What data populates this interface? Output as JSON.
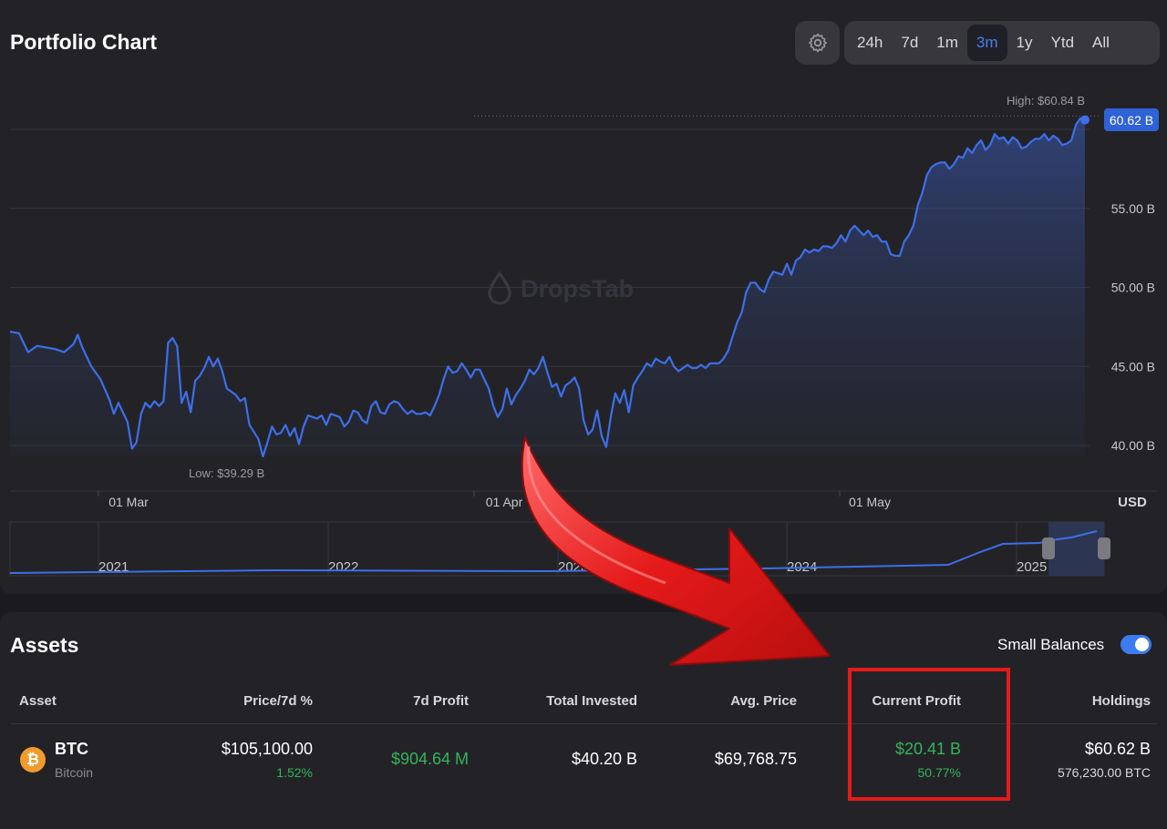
{
  "header": {
    "title": "Portfolio Chart",
    "settings_icon": "gear-icon",
    "ranges": [
      "24h",
      "7d",
      "1m",
      "3m",
      "1y",
      "Ytd",
      "All"
    ],
    "active_range": "3m"
  },
  "chart": {
    "watermark": "DropsTab",
    "high_label": "High: $60.84 B",
    "low_label": "Low: $39.29 B",
    "current_badge": "60.62 B",
    "currency": "USD",
    "navigator_years": [
      "2021",
      "2022",
      "2023",
      "2024",
      "2025"
    ]
  },
  "chart_data": {
    "type": "area",
    "title": "Portfolio Chart",
    "ylabel": "USD",
    "y_ticks": [
      "40.00 B",
      "45.00 B",
      "50.00 B",
      "55.00 B"
    ],
    "x_ticks": [
      "01 Mar",
      "01 Apr",
      "01 May"
    ],
    "ylim": [
      37.1,
      62.2
    ],
    "high": 60.84,
    "low": 39.29,
    "current": 60.62,
    "series": [
      {
        "color": "#3d6fe8",
        "points": [
          [
            0,
            47.2
          ],
          [
            2,
            47.1
          ],
          [
            4,
            45.9
          ],
          [
            6,
            46.3
          ],
          [
            8,
            46.2
          ],
          [
            10,
            46.1
          ],
          [
            12,
            45.9
          ],
          [
            14,
            46.4
          ],
          [
            15,
            47.0
          ],
          [
            16,
            46.2
          ],
          [
            18,
            45.0
          ],
          [
            19,
            44.6
          ],
          [
            20,
            44.2
          ],
          [
            22,
            42.9
          ],
          [
            23,
            42.0
          ],
          [
            24,
            42.7
          ],
          [
            26,
            41.5
          ],
          [
            27,
            39.8
          ],
          [
            28,
            40.2
          ],
          [
            29,
            42.0
          ],
          [
            30,
            42.7
          ],
          [
            31,
            42.4
          ],
          [
            32,
            42.8
          ],
          [
            33,
            42.5
          ],
          [
            34,
            42.8
          ],
          [
            35,
            46.5
          ],
          [
            36,
            46.8
          ],
          [
            37,
            46.3
          ],
          [
            38,
            42.7
          ],
          [
            39,
            43.4
          ],
          [
            40,
            42.1
          ],
          [
            41,
            44.1
          ],
          [
            42,
            44.4
          ],
          [
            43,
            44.9
          ],
          [
            44,
            45.6
          ],
          [
            45,
            45.0
          ],
          [
            46,
            45.5
          ],
          [
            47,
            44.7
          ],
          [
            48,
            43.6
          ],
          [
            50,
            43.2
          ],
          [
            51,
            42.8
          ],
          [
            52,
            43.0
          ],
          [
            53,
            41.3
          ],
          [
            55,
            40.4
          ],
          [
            56,
            39.3
          ],
          [
            57,
            40.2
          ],
          [
            58,
            41.2
          ],
          [
            59,
            40.7
          ],
          [
            60,
            40.8
          ],
          [
            61,
            41.3
          ],
          [
            62,
            40.6
          ],
          [
            63,
            41.1
          ],
          [
            64,
            40.1
          ],
          [
            65,
            41.2
          ],
          [
            66,
            41.9
          ],
          [
            67,
            41.8
          ],
          [
            68,
            41.7
          ],
          [
            69,
            41.9
          ],
          [
            70,
            41.3
          ],
          [
            71,
            42.0
          ],
          [
            72,
            41.9
          ],
          [
            73,
            41.8
          ],
          [
            74,
            41.2
          ],
          [
            75,
            41.5
          ],
          [
            76,
            42.2
          ],
          [
            77,
            42.1
          ],
          [
            78,
            41.6
          ],
          [
            79,
            41.4
          ],
          [
            80,
            42.5
          ],
          [
            81,
            42.8
          ],
          [
            82,
            42.1
          ],
          [
            83,
            42.0
          ],
          [
            84,
            42.6
          ],
          [
            85,
            42.8
          ],
          [
            86,
            42.7
          ],
          [
            87,
            42.3
          ],
          [
            88,
            42.0
          ],
          [
            89,
            42.2
          ],
          [
            90,
            42.0
          ],
          [
            91,
            42.0
          ],
          [
            92,
            42.1
          ],
          [
            93,
            41.9
          ],
          [
            94,
            42.5
          ],
          [
            95,
            43.2
          ],
          [
            96,
            44.2
          ],
          [
            97,
            45.0
          ],
          [
            98,
            44.6
          ],
          [
            99,
            44.7
          ],
          [
            100,
            45.2
          ],
          [
            101,
            44.8
          ],
          [
            102,
            44.3
          ],
          [
            103,
            44.8
          ],
          [
            104,
            44.8
          ],
          [
            105,
            44.2
          ],
          [
            106,
            43.6
          ],
          [
            107,
            42.5
          ],
          [
            108,
            41.8
          ],
          [
            109,
            42.3
          ],
          [
            110,
            43.6
          ],
          [
            111,
            42.6
          ],
          [
            112,
            43.2
          ],
          [
            113,
            43.6
          ],
          [
            114,
            44.1
          ],
          [
            115,
            44.8
          ],
          [
            116,
            44.5
          ],
          [
            117,
            44.9
          ],
          [
            118,
            45.6
          ],
          [
            119,
            44.6
          ],
          [
            120,
            43.7
          ],
          [
            121,
            43.9
          ],
          [
            122,
            43.1
          ],
          [
            123,
            43.8
          ],
          [
            124,
            44.0
          ],
          [
            125,
            44.3
          ],
          [
            126,
            43.6
          ],
          [
            127,
            41.6
          ],
          [
            128,
            40.7
          ],
          [
            129,
            41.0
          ],
          [
            130,
            42.2
          ],
          [
            131,
            40.6
          ],
          [
            132,
            39.9
          ],
          [
            133,
            41.8
          ],
          [
            134,
            43.3
          ],
          [
            135,
            42.7
          ],
          [
            136,
            43.5
          ],
          [
            137,
            42.1
          ],
          [
            138,
            43.8
          ],
          [
            139,
            44.3
          ],
          [
            140,
            44.7
          ],
          [
            141,
            45.2
          ],
          [
            142,
            45.0
          ],
          [
            143,
            45.5
          ],
          [
            144,
            45.3
          ],
          [
            145,
            45.2
          ],
          [
            146,
            45.6
          ],
          [
            147,
            45.0
          ],
          [
            148,
            44.7
          ],
          [
            149,
            44.9
          ],
          [
            150,
            45.1
          ],
          [
            151,
            44.9
          ],
          [
            152,
            44.9
          ],
          [
            153,
            45.1
          ],
          [
            154,
            44.9
          ],
          [
            155,
            45.2
          ],
          [
            156,
            45.2
          ],
          [
            157,
            45.2
          ],
          [
            158,
            45.5
          ],
          [
            159,
            46.0
          ],
          [
            160,
            46.9
          ],
          [
            161,
            47.8
          ],
          [
            162,
            48.4
          ],
          [
            163,
            49.7
          ],
          [
            164,
            50.3
          ],
          [
            165,
            50.3
          ],
          [
            166,
            49.9
          ],
          [
            167,
            49.7
          ],
          [
            168,
            50.5
          ],
          [
            169,
            51.0
          ],
          [
            170,
            50.9
          ],
          [
            171,
            50.8
          ],
          [
            172,
            51.5
          ],
          [
            173,
            50.8
          ],
          [
            174,
            51.7
          ],
          [
            175,
            51.9
          ],
          [
            176,
            52.4
          ],
          [
            177,
            52.2
          ],
          [
            178,
            52.4
          ],
          [
            179,
            52.3
          ],
          [
            180,
            52.6
          ],
          [
            181,
            52.6
          ],
          [
            182,
            52.5
          ],
          [
            183,
            52.8
          ],
          [
            184,
            53.3
          ],
          [
            185,
            52.9
          ],
          [
            186,
            53.6
          ],
          [
            187,
            53.9
          ],
          [
            188,
            53.6
          ],
          [
            189,
            53.3
          ],
          [
            190,
            53.6
          ],
          [
            191,
            53.2
          ],
          [
            192,
            53.3
          ],
          [
            193,
            52.9
          ],
          [
            194,
            52.9
          ],
          [
            195,
            52.1
          ],
          [
            196,
            52.0
          ],
          [
            197,
            52.0
          ],
          [
            198,
            52.9
          ],
          [
            199,
            53.3
          ],
          [
            200,
            53.9
          ],
          [
            201,
            55.2
          ],
          [
            202,
            56.0
          ],
          [
            203,
            57.1
          ],
          [
            204,
            57.6
          ],
          [
            205,
            57.8
          ],
          [
            206,
            57.9
          ],
          [
            207,
            57.9
          ],
          [
            208,
            57.5
          ],
          [
            209,
            57.8
          ],
          [
            210,
            58.3
          ],
          [
            211,
            58.2
          ],
          [
            212,
            58.8
          ],
          [
            213,
            58.5
          ],
          [
            214,
            59.0
          ],
          [
            215,
            59.3
          ],
          [
            216,
            58.7
          ],
          [
            217,
            59.0
          ],
          [
            218,
            59.7
          ],
          [
            219,
            59.4
          ],
          [
            220,
            59.5
          ],
          [
            221,
            59.1
          ],
          [
            222,
            59.5
          ],
          [
            223,
            59.3
          ],
          [
            224,
            58.8
          ],
          [
            225,
            58.9
          ],
          [
            226,
            59.2
          ],
          [
            227,
            59.4
          ],
          [
            228,
            59.4
          ],
          [
            229,
            59.7
          ],
          [
            230,
            59.3
          ],
          [
            231,
            59.6
          ],
          [
            232,
            59.4
          ],
          [
            233,
            59.0
          ],
          [
            234,
            59.1
          ],
          [
            235,
            59.3
          ],
          [
            236,
            60.3
          ],
          [
            237,
            60.7
          ],
          [
            238,
            60.6
          ]
        ]
      }
    ]
  },
  "assets": {
    "title": "Assets",
    "small_balances_label": "Small Balances",
    "columns": [
      "Asset",
      "Price/7d %",
      "7d Profit",
      "Total Invested",
      "Avg. Price",
      "Current Profit",
      "Holdings"
    ],
    "row": {
      "symbol": "BTC",
      "name": "Bitcoin",
      "price": "$105,100.00",
      "change_7d": "1.52%",
      "profit_7d": "$904.64 M",
      "total_invested": "$40.20 B",
      "avg_price": "$69,768.75",
      "current_profit": "$20.41 B",
      "current_profit_pct": "50.77%",
      "holdings_value": "$60.62 B",
      "holdings_amount": "576,230.00 BTC"
    }
  }
}
